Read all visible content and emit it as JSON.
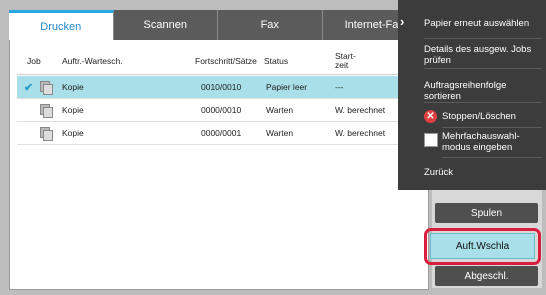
{
  "tabs": [
    {
      "label": "Drucken"
    },
    {
      "label": "Scannen"
    },
    {
      "label": "Fax"
    },
    {
      "label": "Internet-Fax"
    }
  ],
  "table": {
    "headers": {
      "job": "Job",
      "queue": "Auftr.-Wartesch.",
      "progress": "Fortschritt/Sätze",
      "status": "Status",
      "start_line1": "Start-",
      "start_line2": "zeit"
    },
    "rows": [
      {
        "name": "Kopie",
        "progress": "0010/0010",
        "status": "Papier leer",
        "start": "---",
        "selected": true
      },
      {
        "name": "Kopie",
        "progress": "0000/0010",
        "status": "Warten",
        "start": "W. berechnet",
        "selected": false
      },
      {
        "name": "Kopie",
        "progress": "0000/0001",
        "status": "Warten",
        "start": "W. berechnet",
        "selected": false
      }
    ]
  },
  "menu": {
    "items": [
      {
        "label": "Papier erneut auswählen"
      },
      {
        "label": "Details des ausgew. Jobs prüfen"
      },
      {
        "label": "Auftragsreihenfolge sortieren"
      },
      {
        "label": "Stoppen/Löschen"
      },
      {
        "label": "Mehrfachauswahl-modus eingeben"
      },
      {
        "label": "Zurück"
      }
    ]
  },
  "sidebar": {
    "spool": "Spulen",
    "queue": "Auft.Wschla",
    "completed": "Abgeschl."
  }
}
